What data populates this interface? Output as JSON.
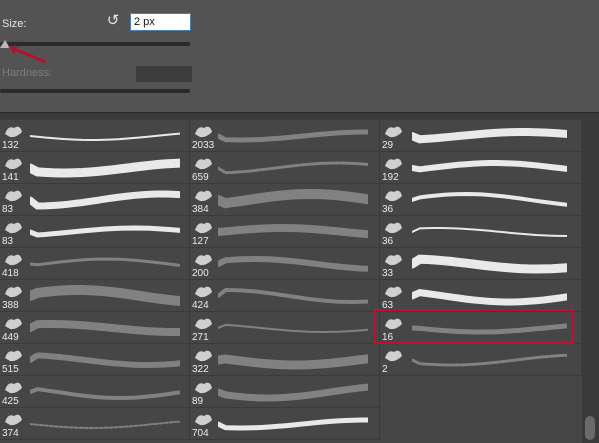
{
  "size": {
    "label": "Size:",
    "value": "2 px",
    "reset_icon": "reset-icon",
    "level": 0.02
  },
  "hardness": {
    "label": "Hardness:"
  },
  "colors": {
    "panel": "#535353",
    "grid": "#464646",
    "highlight": "#c40e2e",
    "arrow": "#b0132e"
  },
  "brushes": {
    "col1": [
      "132",
      "141",
      "83",
      "83",
      "418",
      "388",
      "449",
      "515",
      "425",
      "374"
    ],
    "col2": [
      "2033",
      "659",
      "384",
      "127",
      "200",
      "424",
      "271",
      "322",
      "89",
      "704"
    ],
    "col3": [
      "29",
      "192",
      "36",
      "36",
      "33",
      "63",
      "16",
      "2"
    ]
  },
  "selected_brush": "16"
}
